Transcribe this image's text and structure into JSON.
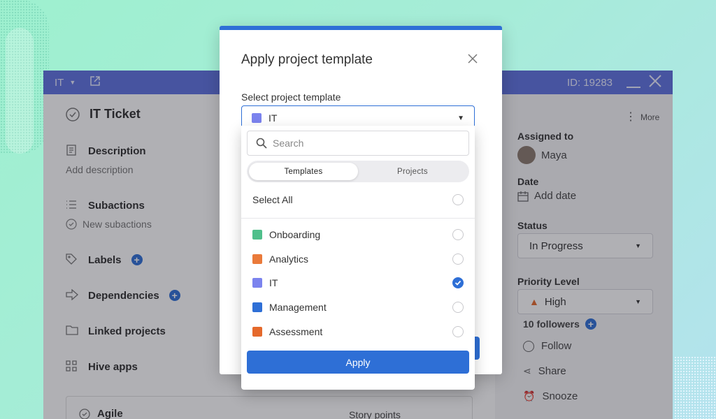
{
  "background_window": {
    "project": "IT",
    "id_text": "ID: 19283",
    "title": "IT Ticket",
    "sections": {
      "description": {
        "label": "Description",
        "sub": "Add description"
      },
      "subactions": {
        "label": "Subactions",
        "sub": "New subactions"
      },
      "labels": "Labels",
      "dependencies": "Dependencies",
      "linked_projects": "Linked projects",
      "hive_apps": "Hive apps"
    },
    "agile": {
      "label": "Agile",
      "story_points": "Story points"
    },
    "more": "More",
    "assigned_to": {
      "label": "Assigned to",
      "value": "Maya"
    },
    "date": {
      "label": "Date",
      "value": "Add date"
    },
    "status": {
      "label": "Status",
      "value": "In Progress"
    },
    "priority": {
      "label": "Priority Level",
      "value": "High"
    },
    "followers": "10 followers",
    "actions": {
      "follow": "Follow",
      "share": "Share",
      "snooze": "Snooze"
    }
  },
  "modal": {
    "title": "Apply project template",
    "select_label": "Select project template",
    "selected": "IT"
  },
  "dropdown": {
    "search_placeholder": "Search",
    "tabs": {
      "templates": "Templates",
      "projects": "Projects",
      "active": "Templates"
    },
    "select_all": "Select All",
    "items": [
      {
        "label": "Onboarding",
        "color": "#4fbf8b",
        "checked": false
      },
      {
        "label": "Analytics",
        "color": "#ea7a3a",
        "checked": false
      },
      {
        "label": "IT",
        "color": "#7b83ee",
        "checked": true
      },
      {
        "label": "Management",
        "color": "#2e6fd6",
        "checked": false
      },
      {
        "label": "Assessment",
        "color": "#e5692b",
        "checked": false
      }
    ],
    "apply": "Apply"
  },
  "colors": {
    "accent": "#2e6fd6",
    "header": "#5f72e0"
  }
}
